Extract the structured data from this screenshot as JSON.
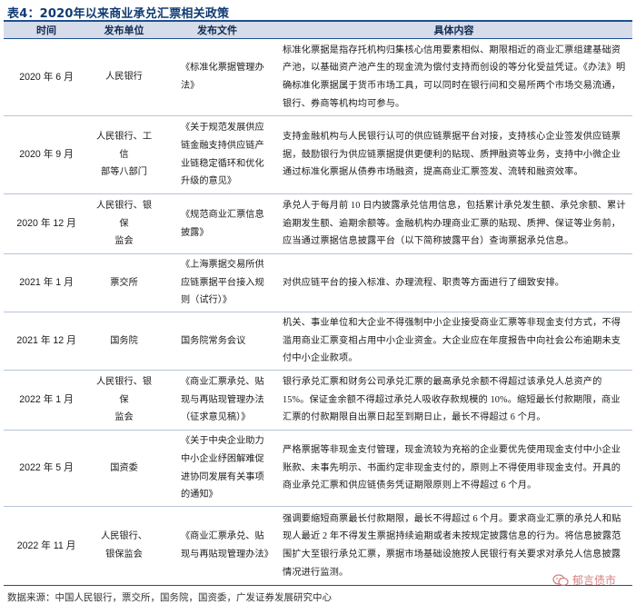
{
  "title": "表4：2020年以来商业承兑汇票相关政策",
  "table": {
    "headers": [
      "时间",
      "发布单位",
      "发布文件",
      "具体内容"
    ],
    "rows": [
      {
        "date": "2020 年 6 月",
        "publisher": "人民银行",
        "document": "《标准化票据管理办法》",
        "content": "标准化票据是指存托机构归集核心信用要素相似、期限相近的商业汇票组建基础资产池，以基础资产池产生的现金流为偿付支持而创设的等分化受益凭证。《办法》明确标准化票据属于货币市场工具，可以同时在银行间和交易所两个市场交易流通，银行、券商等机构均可参与。"
      },
      {
        "date": "2020 年 9 月",
        "publisher": "人民银行、工信\n部等八部门",
        "document": "《关于规范发展供应链金融支持供应链产业链稳定循环和优化升级的意见》",
        "content": "支持金融机构与人民银行认可的供应链票据平台对接，支持核心企业签发供应链票据，鼓励银行为供应链票据提供更便利的贴现、质押融资等业务，支持中小微企业通过标准化票据从债券市场融资，提高商业汇票签发、流转和融资效率。"
      },
      {
        "date": "2020 年 12 月",
        "publisher": "人民银行、银保\n监会",
        "document": "《规范商业汇票信息披露》",
        "content": "承兑人于每月前 10 日内披露承兑信用信息，包括累计承兑发生额、承兑余额、累计逾期发生额、逾期余额等。金融机构办理商业汇票的贴现、质押、保证等业务前，应当通过票据信息披露平台（以下简称披露平台）查询票据承兑信息。"
      },
      {
        "date": "2021 年 1 月",
        "publisher": "票交所",
        "document": "《上海票据交易所供应链票据平台接入规则（试行）》",
        "content": "对供应链平台的接入标准、办理流程、职责等方面进行了细致安排。"
      },
      {
        "date": "2021 年 12 月",
        "publisher": "国务院",
        "document": "国务院常务会议",
        "content": "机关、事业单位和大企业不得强制中小企业接受商业汇票等非现金支付方式，不得滥用商业汇票变相占用中小企业资金。大企业应在年度报告中向社会公布逾期未支付中小企业款项。"
      },
      {
        "date": "2022 年 1 月",
        "publisher": "人民银行、银保\n监会",
        "document": "《商业汇票承兑、贴现与再贴现管理办法（征求意见稿）》",
        "content": "银行承兑汇票和财务公司承兑汇票的最高承兑余额不得超过该承兑人总资产的 15%。保证金余额不得超过承兑人吸收存款规模的 10%。缩短最长付款期限，商业汇票的付款期限自出票日起至到期日止，最长不得超过 6 个月。"
      },
      {
        "date": "2022 年 5 月",
        "publisher": "国资委",
        "document": "《关于中央企业助力中小企业纾困解难促进协同发展有关事项的通知》",
        "content": "严格票据等非现金支付管理，现金流较为充裕的企业要优先使用现金支付中小企业账款、未事先明示、书面约定非现金支付的，原则上不得使用非现金支付。开具的商业承兑汇票和供应链债务凭证期限原则上不得超过 6 个月。"
      },
      {
        "date": "2022 年 11 月",
        "publisher": "人民银行、\n银保监会",
        "document": "《商业汇票承兑、贴现与再贴现管理办法》",
        "content": "强调要缩短商票最长付款期限，最长不得超过 6 个月。要求商业汇票的承兑人和贴现人最近 2 年不得发生票据持续逾期或者未按规定披露信息的行为。将信息披露范围扩大至银行承兑汇票，票据市场基础设施按人民银行有关要求对承兑人信息披露情况进行监测。"
      }
    ]
  },
  "source": "数据来源：中国人民银行，票交所，国务院，国资委，广发证券发展研究中心",
  "watermark": "郁言债市",
  "colors": {
    "title": "#0f3a73",
    "header_bg": "#d6dcea",
    "rule": "#1d4f8f"
  }
}
